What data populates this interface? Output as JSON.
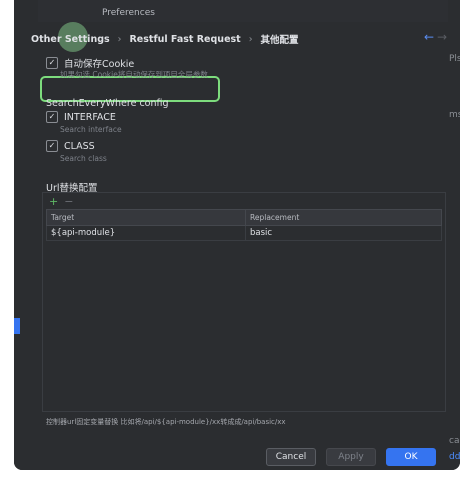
{
  "window": {
    "title": "Preferences"
  },
  "background": {
    "right_texts": [
      "Pls",
      "ms",
      "cal",
      "dd"
    ]
  },
  "breadcrumb": {
    "items": [
      "Other Settings",
      "Restful Fast Request",
      "其他配置"
    ]
  },
  "nav": {
    "back_icon": "arrow-left-icon",
    "forward_icon": "arrow-right-icon"
  },
  "auto_cookie": {
    "label": "自动保存Cookie",
    "checked": true,
    "description": "如果勾选 Cookie将自动保存到项目全局参数"
  },
  "search_config": {
    "title": "SearchEveryWhere config",
    "interface": {
      "label": "INTERFACE",
      "checked": true,
      "description": "Search interface"
    },
    "class": {
      "label": "CLASS",
      "checked": true,
      "description": "Search class"
    }
  },
  "url_replace": {
    "title": "Url替换配置",
    "add_symbol": "+",
    "remove_symbol": "−",
    "columns": [
      "Target",
      "Replacement"
    ],
    "rows": [
      {
        "target": "${api-module}",
        "replacement": "basic"
      }
    ],
    "footnote": "控制器url固定变量替换 比如将/api/${api-module}/xx转成成/api/basic/xx"
  },
  "buttons": {
    "cancel": "Cancel",
    "apply": "Apply",
    "ok": "OK"
  },
  "colors": {
    "accent": "#3574f0",
    "highlight": "#7ddc7d",
    "background": "#2b2d30"
  }
}
